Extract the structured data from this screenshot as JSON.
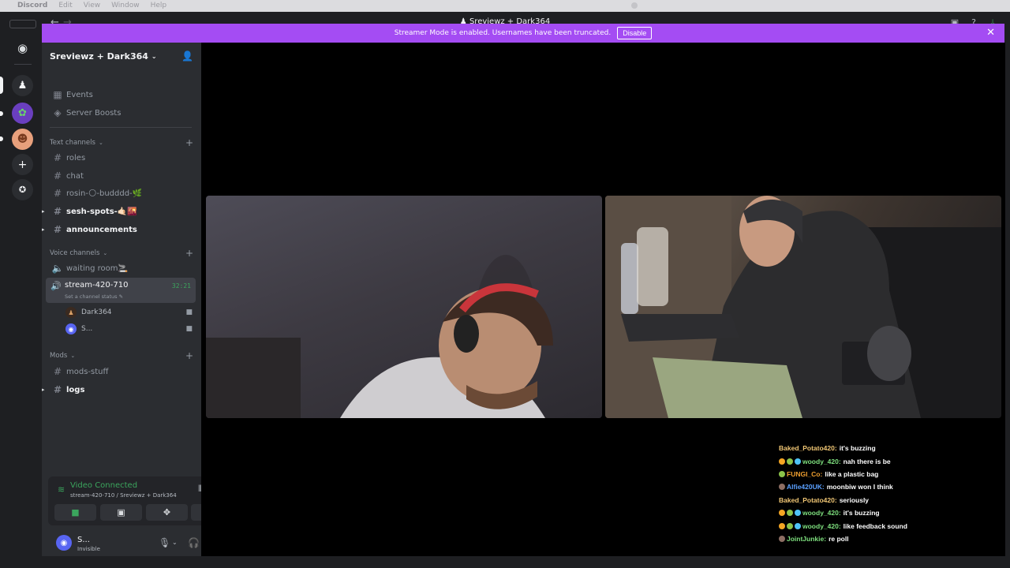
{
  "mac_menu": {
    "app": "Discord",
    "items": [
      "Edit",
      "View",
      "Window",
      "Help"
    ]
  },
  "window": {
    "title": "Sreviewz + Dark364"
  },
  "banner": {
    "text": "Streamer Mode is enabled. Usernames have been truncated.",
    "button": "Disable"
  },
  "server": {
    "name": "Sreviewz + Dark364"
  },
  "nav_items": [
    {
      "label": "Events"
    },
    {
      "label": "Server Boosts"
    }
  ],
  "text_category": "Text channels",
  "text_channels": [
    {
      "label": "roles"
    },
    {
      "label": "chat"
    },
    {
      "label": "rosin-🌕-budddd-🌿"
    },
    {
      "label": "sesh-spots-🤙🏻🌇"
    },
    {
      "label": "announcements"
    }
  ],
  "voice_category": "Voice channels",
  "voice_channels": [
    {
      "label": "waiting room🚬"
    },
    {
      "label": "stream-420-710",
      "time": "32:21",
      "status": "Set a channel status"
    }
  ],
  "voice_users": [
    {
      "name": "Dark364"
    },
    {
      "name": "S..."
    }
  ],
  "mods_category": "Mods",
  "mods_channels": [
    {
      "label": "mods-stuff"
    },
    {
      "label": "logs"
    }
  ],
  "voice_panel": {
    "status": "Video Connected",
    "location": "stream-420-710 / Sreviewz + Dark364"
  },
  "user": {
    "name": "S...",
    "status": "Invisible"
  },
  "colors": {
    "accent": "#a44cf3",
    "connected": "#3ba55d",
    "blurple": "#5865f2"
  },
  "chat": [
    {
      "badges": [],
      "user": "Baked_Potato420",
      "color": "#f0c674",
      "text": "it's buzzing"
    },
    {
      "badges": [
        "#f5a623",
        "#8bc34a",
        "#4fc3f7"
      ],
      "user": "woody_420",
      "color": "#7ee07e",
      "text": "nah there is be"
    },
    {
      "badges": [
        "#8bc34a"
      ],
      "user": "FUNGI_Co",
      "color": "#f0a030",
      "text": "like a plastic bag"
    },
    {
      "badges": [
        "#8d6e63"
      ],
      "user": "Alfie420UK",
      "color": "#5aa0ff",
      "text": "moonbiw won I think"
    },
    {
      "badges": [],
      "user": "Baked_Potato420",
      "color": "#f0c674",
      "text": "seriously"
    },
    {
      "badges": [
        "#f5a623",
        "#8bc34a",
        "#4fc3f7"
      ],
      "user": "woody_420",
      "color": "#7ee07e",
      "text": "it's buzzing"
    },
    {
      "badges": [
        "#f5a623",
        "#8bc34a",
        "#4fc3f7"
      ],
      "user": "woody_420",
      "color": "#7ee07e",
      "text": "like feedback sound"
    },
    {
      "badges": [
        "#8d6e63"
      ],
      "user": "JointJunkie",
      "color": "#7ee07e",
      "text": "re poll"
    }
  ]
}
